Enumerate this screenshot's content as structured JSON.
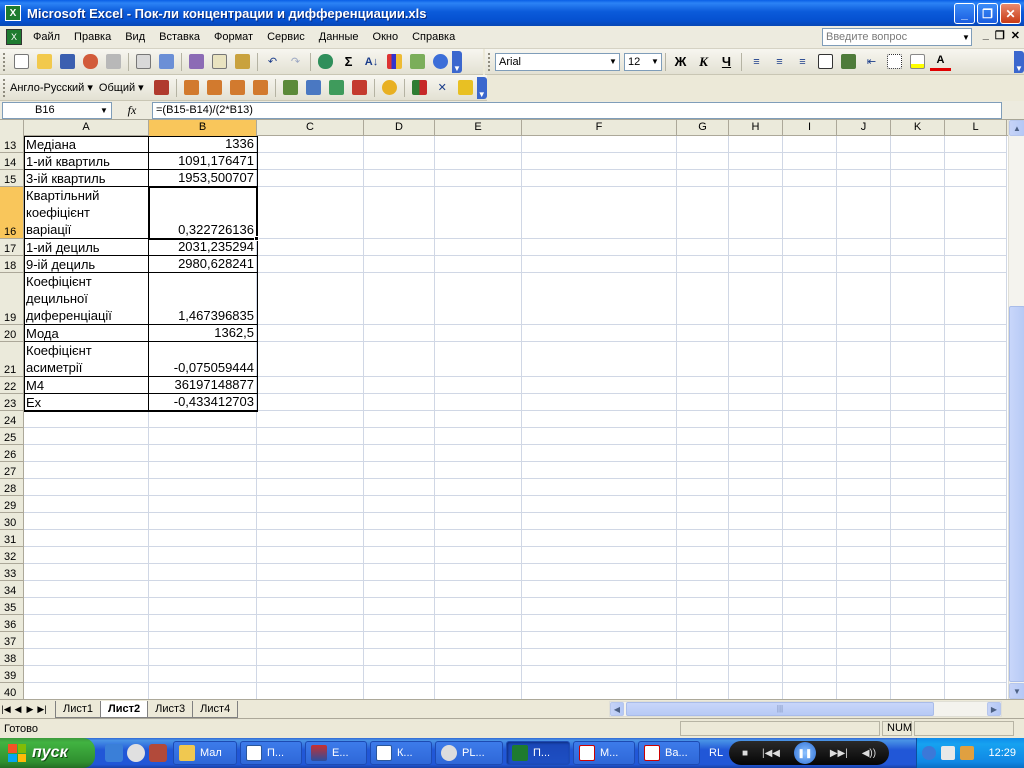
{
  "window": {
    "title": "Microsoft Excel - Пок-ли концентрации и дифференциации.xls",
    "controls": [
      "_",
      "❐",
      "✕"
    ]
  },
  "menu": {
    "items": [
      "Файл",
      "Правка",
      "Вид",
      "Вставка",
      "Формат",
      "Сервис",
      "Данные",
      "Окно",
      "Справка"
    ],
    "help_placeholder": "Введите вопрос",
    "doc_controls": [
      "_",
      "❐",
      "✕"
    ]
  },
  "toolbar": {
    "font_name": "Arial",
    "font_size": "12",
    "bold": "Ж",
    "italic": "К",
    "underline": "Ч",
    "sigma": "Σ",
    "font_color_letter": "A"
  },
  "toolbar2": {
    "lang_pair": "Англо-Русский",
    "dict": "Общий"
  },
  "formula_bar": {
    "name_box": "B16",
    "fx": "fx",
    "formula": "=(B15-B14)/(2*B13)"
  },
  "columns": [
    "A",
    "B",
    "C",
    "D",
    "E",
    "F",
    "G",
    "H",
    "I",
    "J",
    "K",
    "L"
  ],
  "selected_column": "B",
  "selected_row": "16",
  "rows": [
    {
      "n": "13",
      "a": "Медіана",
      "b": "1336"
    },
    {
      "n": "14",
      "a": "1-ий квартиль",
      "b": "1091,176471"
    },
    {
      "n": "15",
      "a": "3-ій квартиль",
      "b": "1953,500707"
    },
    {
      "n": "16",
      "a": "Квартільний\nкоефіцієнт\nваріації",
      "b": "0,322726136"
    },
    {
      "n": "17",
      "a": "1-ий дециль",
      "b": "2031,235294"
    },
    {
      "n": "18",
      "a": "9-ій дециль",
      "b": "2980,628241"
    },
    {
      "n": "19",
      "a": "Коефіцієнт\nдецильної\nдиференціації",
      "b": "1,467396835"
    },
    {
      "n": "20",
      "a": "Мода",
      "b": "1362,5"
    },
    {
      "n": "21",
      "a": "Коефіцієнт\nасиметрії",
      "b": "-0,075059444"
    },
    {
      "n": "22",
      "a": "M4",
      "b": "36197148877"
    },
    {
      "n": "23",
      "a": "Ex",
      "b": "-0,433412703"
    },
    {
      "n": "24",
      "a": "",
      "b": ""
    },
    {
      "n": "25",
      "a": "",
      "b": ""
    },
    {
      "n": "26",
      "a": "",
      "b": ""
    },
    {
      "n": "27",
      "a": "",
      "b": ""
    },
    {
      "n": "28",
      "a": "",
      "b": ""
    },
    {
      "n": "29",
      "a": "",
      "b": ""
    },
    {
      "n": "30",
      "a": "",
      "b": ""
    },
    {
      "n": "31",
      "a": "",
      "b": ""
    },
    {
      "n": "32",
      "a": "",
      "b": ""
    },
    {
      "n": "33",
      "a": "",
      "b": ""
    },
    {
      "n": "34",
      "a": "",
      "b": ""
    },
    {
      "n": "35",
      "a": "",
      "b": ""
    },
    {
      "n": "36",
      "a": "",
      "b": ""
    },
    {
      "n": "37",
      "a": "",
      "b": ""
    },
    {
      "n": "38",
      "a": "",
      "b": ""
    },
    {
      "n": "39",
      "a": "",
      "b": ""
    },
    {
      "n": "40",
      "a": "",
      "b": ""
    }
  ],
  "sheets": [
    {
      "name": "Лист1",
      "active": false
    },
    {
      "name": "Лист2",
      "active": true
    },
    {
      "name": "Лист3",
      "active": false
    },
    {
      "name": "Лист4",
      "active": false
    }
  ],
  "status": {
    "ready": "Готово",
    "num": "NUM"
  },
  "taskbar": {
    "start": "пуск",
    "buttons": [
      {
        "label": "Мал",
        "active": false
      },
      {
        "label": "П...",
        "active": false
      },
      {
        "label": "E...",
        "active": false
      },
      {
        "label": "К...",
        "active": false
      },
      {
        "label": "PL...",
        "active": false
      },
      {
        "label": "П...",
        "active": true
      },
      {
        "label": "М...",
        "active": false
      },
      {
        "label": "Ва...",
        "active": false
      }
    ],
    "lang": "RL",
    "clock": "12:29"
  },
  "colors": {
    "selection_header": "#F9C65B",
    "titlebar": "#0B5BDA",
    "start_green": "#3C9A3C"
  }
}
